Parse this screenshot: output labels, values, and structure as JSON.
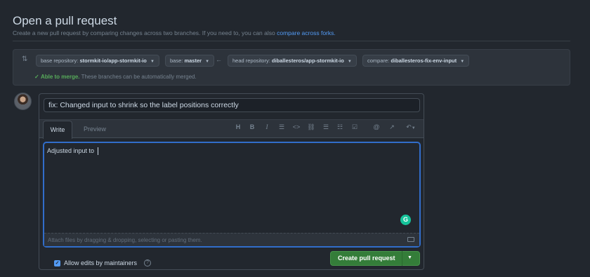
{
  "header": {
    "title": "Open a pull request",
    "subtitle": "Create a new pull request by comparing changes across two branches. If you need to, you can also",
    "subtitle_link": "compare across forks."
  },
  "range": {
    "base_repo_label": "base repository:",
    "base_repo_value": "stormkit-io/app-stormkit-io",
    "base_label": "base:",
    "base_value": "master",
    "arrow": "←",
    "head_repo_label": "head repository:",
    "head_repo_value": "diballesteros/app-stormkit-io",
    "compare_label": "compare:",
    "compare_value": "diballesteros-fix-env-input",
    "merge_status": "Able to merge.",
    "merge_detail": "These branches can be automatically merged."
  },
  "form": {
    "title_value": "fix: Changed input to shrink so the label positions correctly",
    "tabs": [
      "Write",
      "Preview"
    ],
    "toolbar": [
      "H",
      "B",
      "I",
      "☰",
      "<>",
      "🔗",
      "☰",
      "☷",
      "☑",
      "@",
      "↗",
      "↶"
    ],
    "body_value": "Adjusted input to ",
    "attach_text": "Attach files by dragging & dropping, selecting or pasting them.",
    "allow_edits_label": "Allow edits by maintainers",
    "help_glyph": "?",
    "submit_label": "Create pull request"
  },
  "colors": {
    "background": "#22272e",
    "accent_blue": "#316dca",
    "success_green": "#347d39",
    "link": "#539bf5"
  }
}
